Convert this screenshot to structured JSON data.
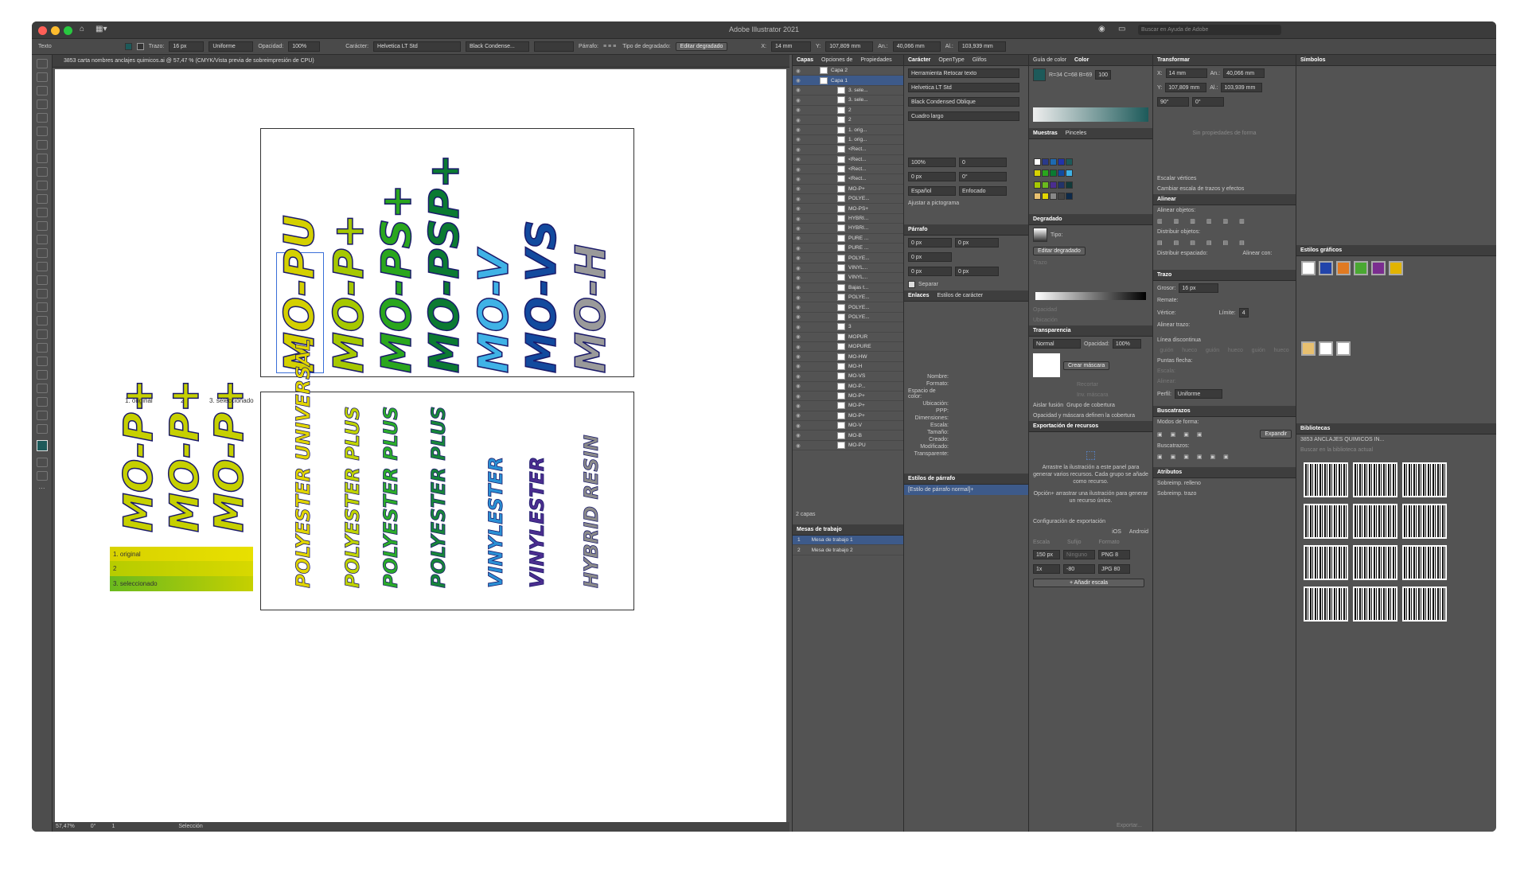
{
  "window": {
    "title": "Adobe Illustrator 2021",
    "search_placeholder": "Buscar en Ayuda de Adobe"
  },
  "control_bar": {
    "mode": "Texto",
    "stroke_label": "Trazo:",
    "stroke_value": "16 px",
    "stroke_style": "Uniforme",
    "opacity_label": "Opacidad:",
    "opacity_value": "100%",
    "char_label": "Carácter:",
    "font": "Helvetica LT Std",
    "style": "Black Condense...",
    "para_label": "Párrafo:",
    "gradient_type_label": "Tipo de degradado:",
    "edit_gradient": "Editar degradado",
    "x_label": "X:",
    "x_value": "14 mm",
    "y_label": "Y:",
    "y_value": "107,809 mm",
    "w_label": "An.:",
    "w_value": "40,066 mm",
    "h_label": "Al.:",
    "h_value": "103,939 mm"
  },
  "document": {
    "tab": "3853 carta nombres anclajes quimicos.ai @ 57,47 % (CMYK/Vista previa de sobreimpresión de CPU)",
    "zoom": "57,47%",
    "rotation": "0°",
    "artboard_num": "1",
    "status_tool": "Selección",
    "labels": [
      "1. original",
      "2",
      "3. seleccionado"
    ],
    "swatch_labels": [
      "1. original",
      "2",
      "3. seleccionado"
    ],
    "top_words": [
      {
        "text": "MO-PU",
        "color": "#d4d000"
      },
      {
        "text": "MO-P+",
        "color": "#a6c800"
      },
      {
        "text": "MO-PS+",
        "color": "#2aa61e"
      },
      {
        "text": "MO-PSP+",
        "color": "#0b7a32"
      },
      {
        "text": "MO-V",
        "color": "#3fb2e6"
      },
      {
        "text": "MO-VS",
        "color": "#124a9e"
      },
      {
        "text": "MO-H",
        "color": "#9a9a9a"
      }
    ],
    "left_words": [
      "MO-P+",
      "MO-P+",
      "MO-P+"
    ],
    "bottom_words": [
      {
        "text": "POLYESTER UNIVERSAL",
        "color": "#e2d600"
      },
      {
        "text": "POLYESTER PLUS",
        "color": "#c0d400"
      },
      {
        "text": "POLYESTER PLUS",
        "color": "#2bab2a"
      },
      {
        "text": "POLYESTER PLUS",
        "color": "#17853a"
      },
      {
        "text": "VINYLESTER",
        "color": "#2a8fd4"
      },
      {
        "text": "VINYLESTER",
        "color": "#4b2d8f"
      },
      {
        "text": "HYBRID RESIN",
        "color": "#8a8a8a"
      }
    ]
  },
  "layers_panel": {
    "tabs": [
      "Capas",
      "Opciones de",
      "Propiedades"
    ],
    "layers": [
      "Capa 2",
      "Capa 1",
      "3. sele...",
      "3. sele...",
      "2",
      "2",
      "1. orig...",
      "1. orig...",
      "<Rect...",
      "<Rect...",
      "<Rect...",
      "<Rect...",
      "MO-P+",
      "POLYE...",
      "MO-PS+",
      "HYBRI...",
      "HYBRI...",
      "PURE ...",
      "PURE ...",
      "POLYE...",
      "VINYL...",
      "VINYL...",
      "Bajas t...",
      "POLYE...",
      "POLYE...",
      "POLYE...",
      "3",
      "MOPUR",
      "MOPURE",
      "MO-HW",
      "MO-H",
      "MO-VS",
      "MO-P...",
      "MO-P+",
      "MO-P+",
      "MO-P+",
      "MO-V",
      "MO-B",
      "MO-PU"
    ],
    "footer": "2 capas",
    "artboards_title": "Mesas de trabajo",
    "artboards": [
      {
        "num": "1",
        "name": "Mesa de trabajo 1"
      },
      {
        "num": "2",
        "name": "Mesa de trabajo 2"
      }
    ]
  },
  "character_panel": {
    "tabs": [
      "Carácter",
      "OpenType",
      "Glifos"
    ],
    "touch": "Herramienta Retocar texto",
    "font": "Helvetica LT Std",
    "style": "Black Condensed Oblique",
    "size_label": "Cuadro largo",
    "scale": "100%",
    "kerning": "0",
    "tracking": "0 px",
    "shift": "0°",
    "lang": "Español",
    "aa": "Enfocado",
    "snap": "Ajustar a pictograma",
    "para_title": "Párrafo",
    "indent": "0 px",
    "hyphen": "Separar",
    "links_tabs": [
      "Enlaces",
      "Estilos de carácter"
    ],
    "link_fields": [
      "Nombre:",
      "Formato:",
      "Espacio de color:",
      "Ubicación:",
      "PPP:",
      "Dimensiones:",
      "Escala:",
      "Tamaño:",
      "Creado:",
      "Modificado:",
      "Transparente:"
    ],
    "pstyles_title": "Estilos de párrafo",
    "pstyle_item": "[Estilo de párrafo normal]+"
  },
  "color_panel": {
    "tabs": [
      "Guía de color",
      "Color"
    ],
    "tint": "100",
    "readout": "R=34 C=68 B=69",
    "swatches_tabs": [
      "Muestras",
      "Pinceles"
    ],
    "gradient_title": "Degradado",
    "type_label": "Tipo:",
    "edit_gradient": "Editar degradado",
    "trazo_label": "Trazo",
    "opacity_lbl": "Opacidad",
    "location_lbl": "Ubicación",
    "transparency_title": "Transparencia",
    "blend": "Normal",
    "opacity_label": "Opacidad:",
    "opacity": "100%",
    "make_mask": "Crear máscara",
    "clip": "Recortar",
    "invert": "Inv. máscara",
    "isolate": "Aislar fusión",
    "knockout": "Grupo de cobertura",
    "opacity_mask": "Opacidad y máscara definen la cobertura",
    "export_title": "Exportación de recursos",
    "export_text": "Arrastre la ilustración a este panel para generar varios recursos. Cada grupo se añade como recurso.",
    "export_text2": "Opción+ arrastrar una ilustración para generar un recurso único.",
    "export_config": "Configuración de exportación",
    "ios": "iOS",
    "android": "Android",
    "scale_label": "Escala",
    "suffix_label": "Sufijo",
    "format_label": "Formato",
    "rows": [
      {
        "scale": "150 px",
        "suffix": "Ninguno",
        "format": "PNG 8"
      },
      {
        "scale": "1x",
        "suffix": "-80",
        "format": "JPG 80"
      }
    ],
    "add_scale": "+ Añadir escala",
    "export_btn": "Exportar..."
  },
  "transform_panel": {
    "title": "Transformar",
    "x": "14 mm",
    "y": "107,809 mm",
    "w": "40,066 mm",
    "h": "103,939 mm",
    "angle": "90°",
    "shear": "0°",
    "no_props": "Sin propiedades de forma",
    "scale_corners": "Escalar vértices",
    "scale_strokes": "Cambiar escala de trazos y efectos",
    "align_title": "Alinear",
    "align_objects": "Alinear objetos:",
    "distribute_objects": "Distribuir objetos:",
    "distribute_spacing": "Distribuir espaciado:",
    "align_to": "Alinear con:",
    "stroke_title": "Trazo",
    "weight_label": "Grosor:",
    "weight": "16 px",
    "cap_label": "Remate:",
    "corner_label": "Vértice:",
    "limit_label": "Límite:",
    "limit": "4",
    "align_stroke": "Alinear trazo:",
    "dashed": "Línea discontinua",
    "dash_labels": [
      "guión",
      "hueco",
      "guión",
      "hueco",
      "guión",
      "hueco"
    ],
    "arrows_label": "Puntas flecha:",
    "scale_lbl": "Escala:",
    "align_lbl": "Alinear:",
    "profile_label": "Perfil:",
    "profile": "Uniforme",
    "pathfinder_title": "Buscatrazos",
    "shape_modes": "Modos de forma:",
    "pathfinders": "Buscatrazos:",
    "expand": "Expandir",
    "attributes_title": "Atributos",
    "overprint_fill": "Sobreimp. relleno",
    "overprint_stroke": "Sobreimp. trazo"
  },
  "symbols_panel": {
    "title": "Símbolos",
    "graphic_styles": "Estilos gráficos",
    "style_colors": [
      "#ffffff",
      "#2244aa",
      "#e07a22",
      "#4aa832",
      "#7a2d8f",
      "#e2b400",
      "#e8c070",
      "#ffffff",
      "#ffffff"
    ],
    "libraries_title": "Bibliotecas",
    "library_name": "3853 ANCLAJES QUIMICOS IN...",
    "search_placeholder": "Buscar en la biblioteca actual"
  },
  "colors": {
    "ui_bg": "#535353",
    "panel_head": "#3e3e3e",
    "selection": "#3a6fd8"
  }
}
